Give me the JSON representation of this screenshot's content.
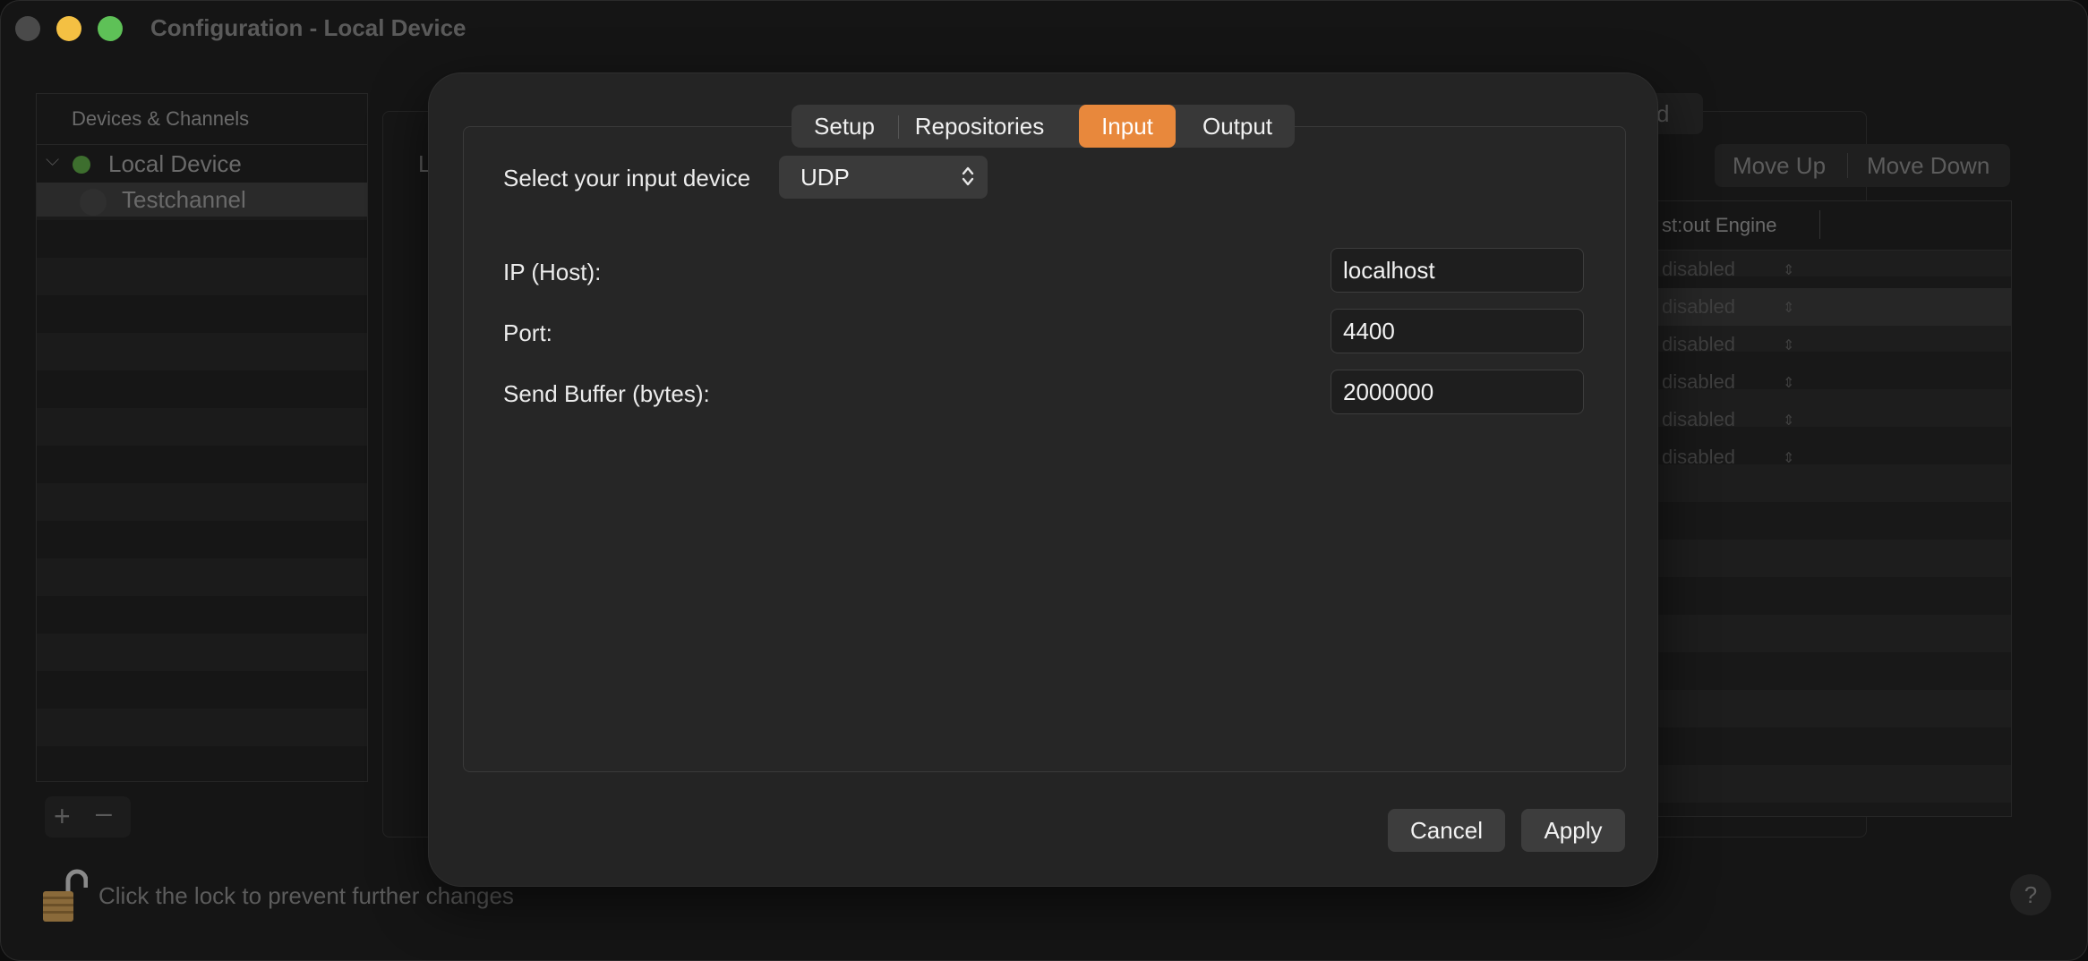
{
  "window": {
    "title": "Configuration - Local Device",
    "traffic_lights": {
      "close_color": "#4a4a4a",
      "minimize_color": "#f4c043",
      "maximize_color": "#5ec157"
    }
  },
  "sidebar": {
    "header": "Devices & Channels",
    "device": {
      "label": "Local Device",
      "status_color": "#3d6e2e",
      "expanded": true
    },
    "channel": {
      "label": "Testchannel",
      "selected": true
    },
    "add_glyph": "+",
    "remove_glyph": "–"
  },
  "background": {
    "content_letter": "L",
    "tab_fragment": "d",
    "move_up": "Move Up",
    "move_down": "Move Down",
    "table_header": "st:out Engine",
    "table_rows": [
      "disabled",
      "disabled",
      "disabled",
      "disabled",
      "disabled",
      "disabled"
    ]
  },
  "footer": {
    "lock_text": "Click the lock to prevent further changes",
    "help_glyph": "?"
  },
  "sheet": {
    "tabs": [
      {
        "label": "Setup",
        "active": false
      },
      {
        "label": "Repositories",
        "active": false
      },
      {
        "label": "Input",
        "active": true
      },
      {
        "label": "Output",
        "active": false
      }
    ],
    "accent_color": "#e8883c",
    "input_device": {
      "label": "Select your input device",
      "value": "UDP"
    },
    "fields": [
      {
        "label": "IP (Host):",
        "value": "localhost"
      },
      {
        "label": "Port:",
        "value": "4400"
      },
      {
        "label": "Send Buffer (bytes):",
        "value": "2000000"
      }
    ],
    "cancel_label": "Cancel",
    "apply_label": "Apply"
  }
}
